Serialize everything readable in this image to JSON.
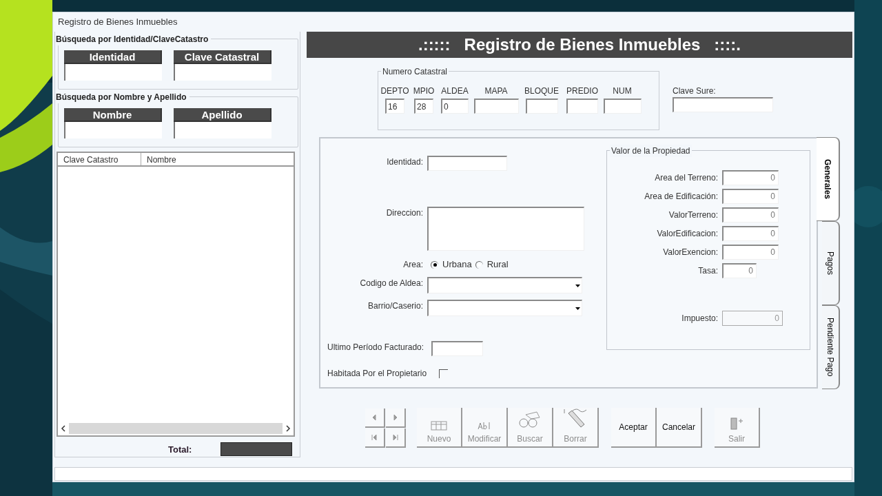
{
  "window": {
    "title": "Registro de Bienes Inmuebles"
  },
  "search_identity": {
    "legend": "Búsqueda por Identidad/ClaveCatastro",
    "fields": [
      {
        "label": "Identidad"
      },
      {
        "label": "Clave Catastral"
      }
    ]
  },
  "search_name": {
    "legend": "Búsqueda por Nombre y Apellido",
    "fields": [
      {
        "label": "Nombre"
      },
      {
        "label": "Apellido"
      }
    ]
  },
  "results": {
    "columns": [
      "Clave Catastro",
      "Nombre"
    ]
  },
  "total": {
    "label": "Total:"
  },
  "header": {
    "title": ".:::::   Registro de Bienes Inmuebles   ::::."
  },
  "numero_catastral": {
    "legend": "Numero Catastral",
    "fields": [
      {
        "label": "DEPTO",
        "value": "16"
      },
      {
        "label": "MPIO",
        "value": "28"
      },
      {
        "label": "ALDEA",
        "value": "0"
      },
      {
        "label": "MAPA"
      },
      {
        "label": "BLOQUE"
      },
      {
        "label": "PREDIO"
      },
      {
        "label": "NUM"
      }
    ]
  },
  "clave_sure": {
    "label": "Clave Sure:"
  },
  "tabs": [
    {
      "label": "Generales",
      "selected": true
    },
    {
      "label": "Pagos",
      "selected": false
    },
    {
      "label": "Pendiente Pago",
      "selected": false
    }
  ],
  "general": {
    "identidad": {
      "label": "Identidad:"
    },
    "direccion": {
      "label": "Direccion:"
    },
    "area": {
      "label": "Area:",
      "options": [
        {
          "label": "Urbana",
          "selected": true
        },
        {
          "label": "Rural",
          "selected": false
        }
      ]
    },
    "codigo_aldea": {
      "label": "Codigo de Aldea:"
    },
    "barrio": {
      "label": "Barrio/Caserio:"
    },
    "ultimo_periodo": {
      "label": "Ultimo Período Facturado:"
    },
    "habitada": {
      "label": "Habitada Por el Propietario",
      "checked": false
    }
  },
  "valor": {
    "legend": "Valor de la Propiedad",
    "fields": [
      {
        "label": "Area del Terreno:",
        "value": "0"
      },
      {
        "label": "Area de Edificación:",
        "value": "0"
      },
      {
        "label": "ValorTerreno:",
        "value": "0"
      },
      {
        "label": "ValorEdificacion:",
        "value": "0"
      },
      {
        "label": "ValorExencion:",
        "value": "0"
      },
      {
        "label": "Tasa:",
        "value": "0"
      }
    ],
    "impuesto": {
      "label": "Impuesto:",
      "value": "0"
    }
  },
  "actions": [
    {
      "label": "Nuevo",
      "disabled": true
    },
    {
      "label": "Modificar",
      "disabled": true
    },
    {
      "label": "Buscar",
      "disabled": true
    },
    {
      "label": "Borrar",
      "disabled": true
    },
    {
      "label": "Aceptar",
      "disabled": false
    },
    {
      "label": "Cancelar",
      "disabled": false
    },
    {
      "label": "Salir",
      "disabled": true
    }
  ]
}
